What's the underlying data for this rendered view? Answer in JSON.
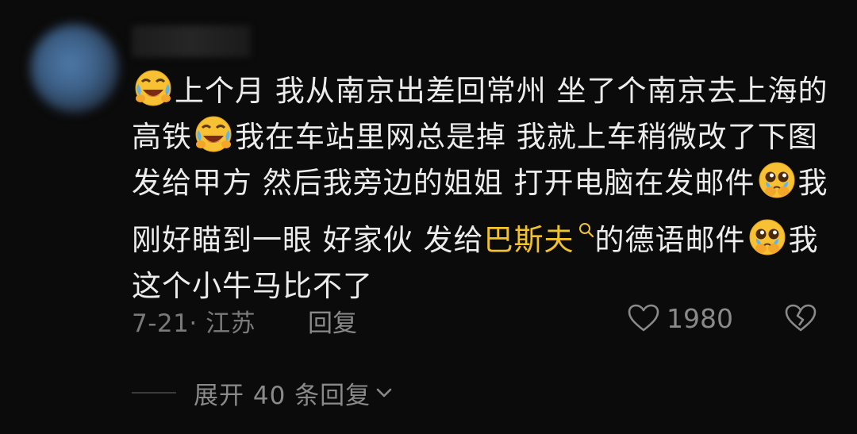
{
  "comment": {
    "segments": [
      {
        "type": "emoji",
        "icon": "laughing-crying-emoji-icon"
      },
      {
        "type": "text",
        "value": "上个月 我从南京出差回常州 坐了个南京去上海的高铁"
      },
      {
        "type": "emoji",
        "icon": "laughing-crying-emoji-icon"
      },
      {
        "type": "text",
        "value": "我在车站里网总是掉 我就上车稍微改了下图发给甲方 然后我旁边的姐姐 打开电脑在发邮件"
      },
      {
        "type": "emoji",
        "icon": "pleading-tears-emoji-icon"
      },
      {
        "type": "text",
        "value": "我刚好瞄到一眼 好家伙 发给"
      },
      {
        "type": "link",
        "value": "巴斯夫"
      },
      {
        "type": "search",
        "icon": "search-icon"
      },
      {
        "type": "text",
        "value": "的德语邮件"
      },
      {
        "type": "emoji",
        "icon": "pleading-tears-emoji-icon"
      },
      {
        "type": "text",
        "value": "我这个小牛马比不了"
      }
    ]
  },
  "meta": {
    "date_location": "7-21· 江苏",
    "reply_label": "回复",
    "like_count": "1980"
  },
  "replies": {
    "expand_label": "展开 40 条回复"
  },
  "colors": {
    "background": "#0b0b0b",
    "text": "#ececec",
    "muted": "#7a7a7a",
    "link": "#f0c22b"
  }
}
